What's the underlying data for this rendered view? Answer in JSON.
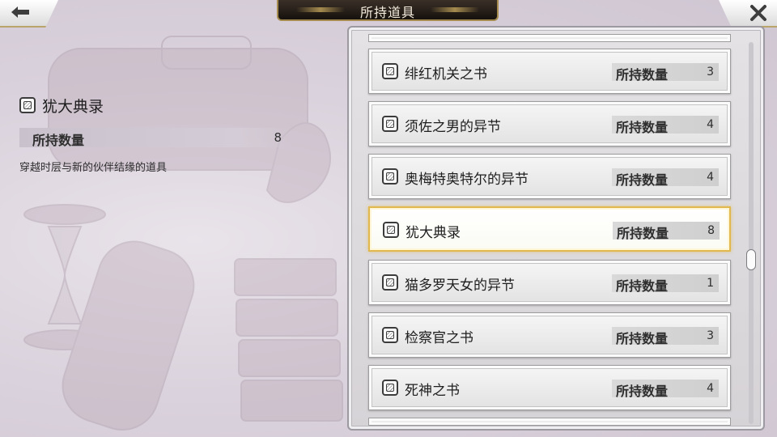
{
  "header": {
    "title": "所持道具",
    "back_icon": "arrow-left-icon",
    "close_icon": "close-x-icon",
    "accent_color": "#a58b4e"
  },
  "detail": {
    "item_name": "犹大典录",
    "qty_label": "所持数量",
    "qty_value": "8",
    "description": "穿越时层与新的伙伴结缘的道具"
  },
  "list": {
    "items": [
      {
        "name": "绯红机关之书",
        "qty_label": "所持数量",
        "qty": "3"
      },
      {
        "name": "须佐之男的异节",
        "qty_label": "所持数量",
        "qty": "4"
      },
      {
        "name": "奥梅特奥特尔的异节",
        "qty_label": "所持数量",
        "qty": "4"
      },
      {
        "name": "犹大典录",
        "qty_label": "所持数量",
        "qty": "8"
      },
      {
        "name": "猫多罗天女的异节",
        "qty_label": "所持数量",
        "qty": "1"
      },
      {
        "name": "检察官之书",
        "qty_label": "所持数量",
        "qty": "3"
      },
      {
        "name": "死神之书",
        "qty_label": "所持数量",
        "qty": "4"
      }
    ],
    "selected_index": 3,
    "selected_color": "#e0b84e"
  }
}
